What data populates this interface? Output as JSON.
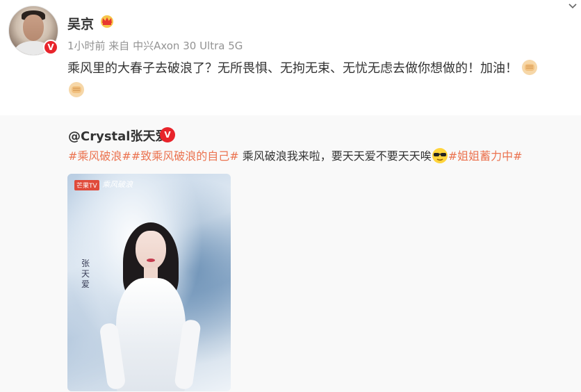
{
  "post": {
    "username": "吴京",
    "meta": "1小时前  来自 中兴Axon 30 Ultra 5G",
    "content": "乘风里的大春子去破浪了？无所畏惧、无拘无束、无忧无虑去做你想做的！加油！",
    "icons": [
      "crown-icon",
      "verified-badge-icon",
      "fist-emoji",
      "chevron-down-icon"
    ]
  },
  "repost": {
    "username": "@Crystal张天爱",
    "tag1": "#乘风破浪#",
    "tag2": "#致乘风破浪的自己#",
    "text": " 乘风破浪我来啦，要天天爱不要天天唉",
    "tag3": "#姐姐蓄力中#",
    "poster": {
      "logo": "芒果TV",
      "brand": "乘风破浪",
      "signature": "张天爱"
    },
    "colors": {
      "tag": "#eb7350",
      "background": "#f9f9f9"
    }
  }
}
